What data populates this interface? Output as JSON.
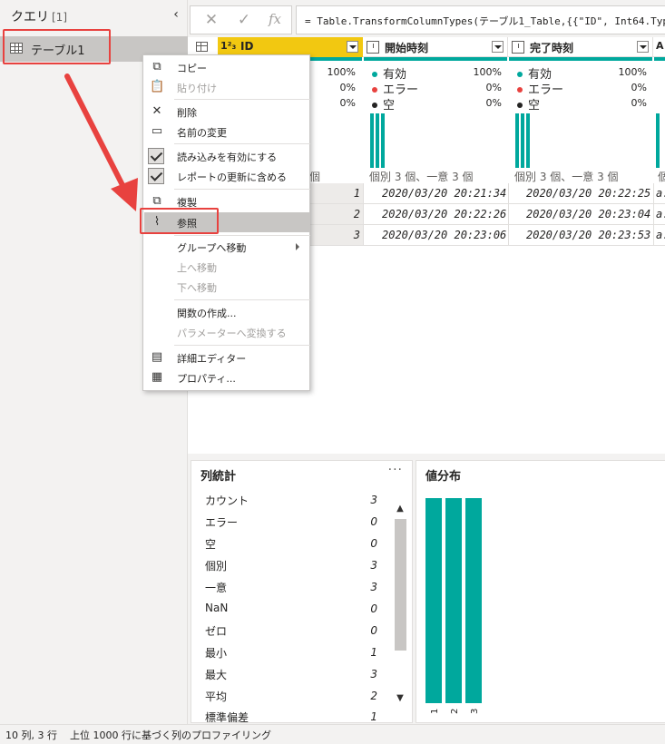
{
  "query_pane": {
    "title": "クエリ",
    "count": "[1]",
    "collapse_glyph": "‹",
    "items": [
      {
        "label": "テーブル1",
        "icon": "table-icon"
      }
    ]
  },
  "formula_bar": {
    "cancel_glyph": "✕",
    "commit_glyph": "✓",
    "fx_glyph": "fx",
    "formula": "= Table.TransformColumnTypes(テーブル1_Table,{{\"ID\", Int64.Type},"
  },
  "grid": {
    "columns": [
      {
        "name": "ID",
        "type_label": "1²₃",
        "selected": true
      },
      {
        "name": "開始時刻",
        "type_label": "datetime",
        "selected": false
      },
      {
        "name": "完了時刻",
        "type_label": "datetime",
        "selected": false
      },
      {
        "name": "A",
        "type_label": "text",
        "selected": false
      }
    ],
    "quality": {
      "id": {
        "valid": "100%",
        "error": "0%",
        "empty": "0%"
      },
      "start": {
        "valid_label": "有効",
        "error_label": "エラー",
        "empty_label": "空",
        "valid": "100%",
        "error": "0%",
        "empty": "0%"
      },
      "end": {
        "valid_label": "有効",
        "error_label": "エラー",
        "empty_label": "空",
        "valid": "100%",
        "error": "0%",
        "empty": "0%"
      }
    },
    "distinct": {
      "id": "個",
      "start": "個別 3 個、一意 3 個",
      "end": "個別 3 個、一意 3 個"
    },
    "rows": [
      {
        "id": "1",
        "start": "2020/03/20 20:21:34",
        "end": "2020/03/20 20:22:25",
        "next": "a:"
      },
      {
        "id": "2",
        "start": "2020/03/20 20:22:26",
        "end": "2020/03/20 20:23:04",
        "next": "a:"
      },
      {
        "id": "3",
        "start": "2020/03/20 20:23:06",
        "end": "2020/03/20 20:23:53",
        "next": "a:"
      }
    ]
  },
  "context_menu": {
    "items": [
      {
        "label": "コピー",
        "icon": "copy-icon",
        "disabled": false
      },
      {
        "label": "貼り付け",
        "icon": "paste-icon",
        "disabled": true
      },
      {
        "label": "削除",
        "icon": "delete-icon",
        "disabled": false
      },
      {
        "label": "名前の変更",
        "icon": "rename-icon",
        "disabled": false
      },
      {
        "label": "読み込みを有効にする",
        "icon": "checkbox-checked",
        "disabled": false
      },
      {
        "label": "レポートの更新に含める",
        "icon": "checkbox-checked",
        "disabled": false
      },
      {
        "label": "複製",
        "icon": "duplicate-icon",
        "disabled": false
      },
      {
        "label": "参照",
        "icon": "paperclip-icon",
        "disabled": false
      },
      {
        "label": "グループへ移動",
        "icon": "",
        "disabled": false
      },
      {
        "label": "上へ移動",
        "icon": "",
        "disabled": true
      },
      {
        "label": "下へ移動",
        "icon": "",
        "disabled": true
      },
      {
        "label": "関数の作成...",
        "icon": "",
        "disabled": false
      },
      {
        "label": "パラメーターへ変換する",
        "icon": "",
        "disabled": true
      },
      {
        "label": "詳細エディター",
        "icon": "advanced-editor-icon",
        "disabled": false
      },
      {
        "label": "プロパティ...",
        "icon": "properties-icon",
        "disabled": false
      }
    ]
  },
  "column_stats": {
    "title": "列統計",
    "more": "···",
    "rows": [
      {
        "name": "カウント",
        "value": "3"
      },
      {
        "name": "エラー",
        "value": "0"
      },
      {
        "name": "空",
        "value": "0"
      },
      {
        "name": "個別",
        "value": "3"
      },
      {
        "name": "一意",
        "value": "3"
      },
      {
        "name": "NaN",
        "value": "0"
      },
      {
        "name": "ゼロ",
        "value": "0"
      },
      {
        "name": "最小",
        "value": "1"
      },
      {
        "name": "最大",
        "value": "3"
      },
      {
        "name": "平均",
        "value": "2"
      },
      {
        "name": "標準偏差",
        "value": "1"
      }
    ]
  },
  "value_distribution": {
    "title": "値分布",
    "categories": [
      "1",
      "2",
      "3"
    ],
    "counts": [
      1,
      1,
      1
    ]
  },
  "status_bar": {
    "columns_rows": "10 列, 3 行",
    "profiling": "上位 1000 行に基づく列のプロファイリング"
  },
  "colors": {
    "accent_teal": "#00a89d",
    "selected_header": "#f2c811",
    "callout_red": "#e8423f",
    "error_dot": "#e8423f",
    "empty_dot": "#252423"
  }
}
